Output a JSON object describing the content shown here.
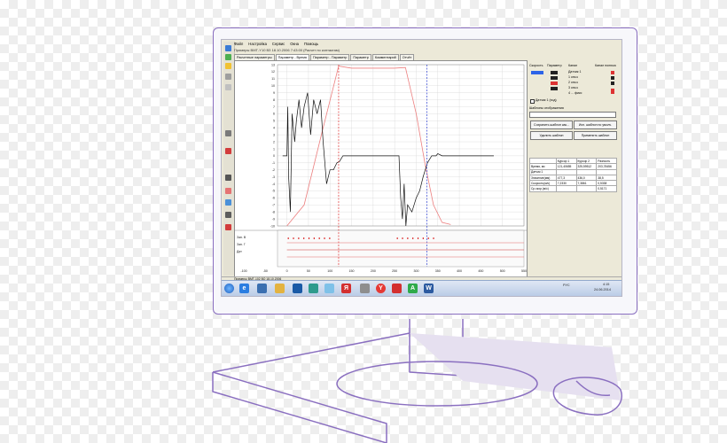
{
  "menu": [
    "Файл",
    "Настройка",
    "Сервис",
    "Окна",
    "Помощь"
  ],
  "title_text": "Примеры ВМТ-Y10 ВЗ 18.10.2006 7:43:00 (Расчет по контактам)",
  "tabs": [
    "Расчетные параметры",
    "Параметр - Время",
    "Параметр - Параметр",
    "Параметр",
    "Комментарий",
    "Отчёт"
  ],
  "active_tab": 1,
  "plot": {
    "y_ticks": [
      "13",
      "12",
      "11",
      "10",
      "9",
      "8",
      "7",
      "6",
      "5",
      "4",
      "3",
      "2",
      "1",
      "0",
      "-1",
      "-2",
      "-3",
      "-4",
      "-5",
      "-6",
      "-7",
      "-8",
      "-9",
      "-10"
    ],
    "x_ticks": [
      "-100",
      "-50",
      "0",
      "50",
      "100",
      "150",
      "200",
      "250",
      "300",
      "350",
      "400",
      "450",
      "500",
      "550"
    ],
    "side_labels": [
      "Зап. В",
      "Зап. Г",
      "Дат"
    ],
    "colors": {
      "trace": "#111111",
      "ramp": "#ec7f7f",
      "cursor1": "#e03030",
      "cursor2": "#2e3fd0",
      "grid": "#d8d8d8"
    }
  },
  "right": {
    "headers": [
      "Скорость",
      "Параметр",
      "Канал",
      "Канал полюса"
    ],
    "channels": [
      "Датчик 1",
      "1 сек.к",
      "2 сек.к",
      "3 сек.к",
      "4 ... фикс"
    ],
    "checkbox_label": "Датчик 1 (ход)",
    "templates_label": "Шаблоны отображения",
    "buttons": [
      "Сохранить шаблон как...",
      "Исп. шаблон по умолч.",
      "Удалить шаблон",
      "Применить шаблон"
    ],
    "table": [
      [
        "",
        "Курсор 1",
        "Курсор 2",
        "Разность"
      ],
      [
        "Время, мс",
        "121,40655",
        "325,59512",
        "203,78456"
      ],
      [
        "Датчик 1",
        "",
        "",
        ""
      ],
      [
        "Значение(мм)",
        "477,3",
        "436,0",
        "38,5"
      ],
      [
        "Скорость(м/с)",
        "7,2330",
        "7,3861",
        "0,5338"
      ],
      [
        "Ср.скор.(м/с)",
        "",
        "",
        "0,5171"
      ]
    ]
  },
  "status_text": "Примеры ВМТ-102 ВО 18.10.2006",
  "tray": {
    "lang": "РУС",
    "time": "4:15",
    "date": "24.06.2014"
  }
}
